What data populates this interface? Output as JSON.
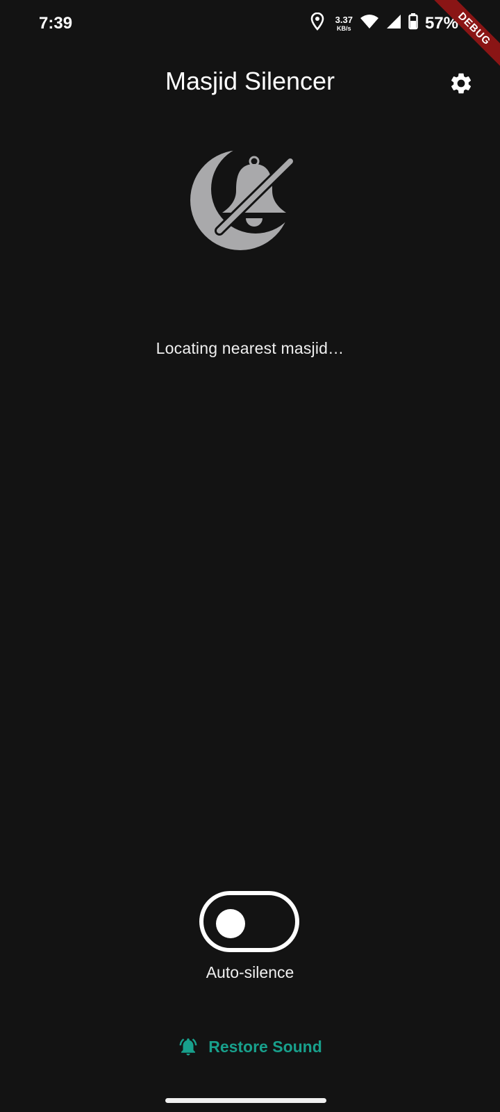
{
  "status_bar": {
    "time": "7:39",
    "net_speed_value": "3.37",
    "net_speed_unit": "KB/s",
    "battery": "57%",
    "icons": [
      "location-icon",
      "wifi-icon",
      "signal-icon",
      "battery-icon"
    ]
  },
  "debug_banner": "DEBUG",
  "app_bar": {
    "title": "Masjid Silencer",
    "settings_icon": "gear-icon"
  },
  "hero": {
    "icon": "crescent-bell-off-icon"
  },
  "status_message": "Locating nearest masjid…",
  "auto_silence": {
    "label": "Auto-silence",
    "enabled": false
  },
  "restore": {
    "label": "Restore Sound",
    "icon": "bell-ringing-icon"
  },
  "colors": {
    "background": "#131313",
    "accent": "#18a08c",
    "icon_gray": "#a9a9ab",
    "debug": "#8a1515"
  }
}
